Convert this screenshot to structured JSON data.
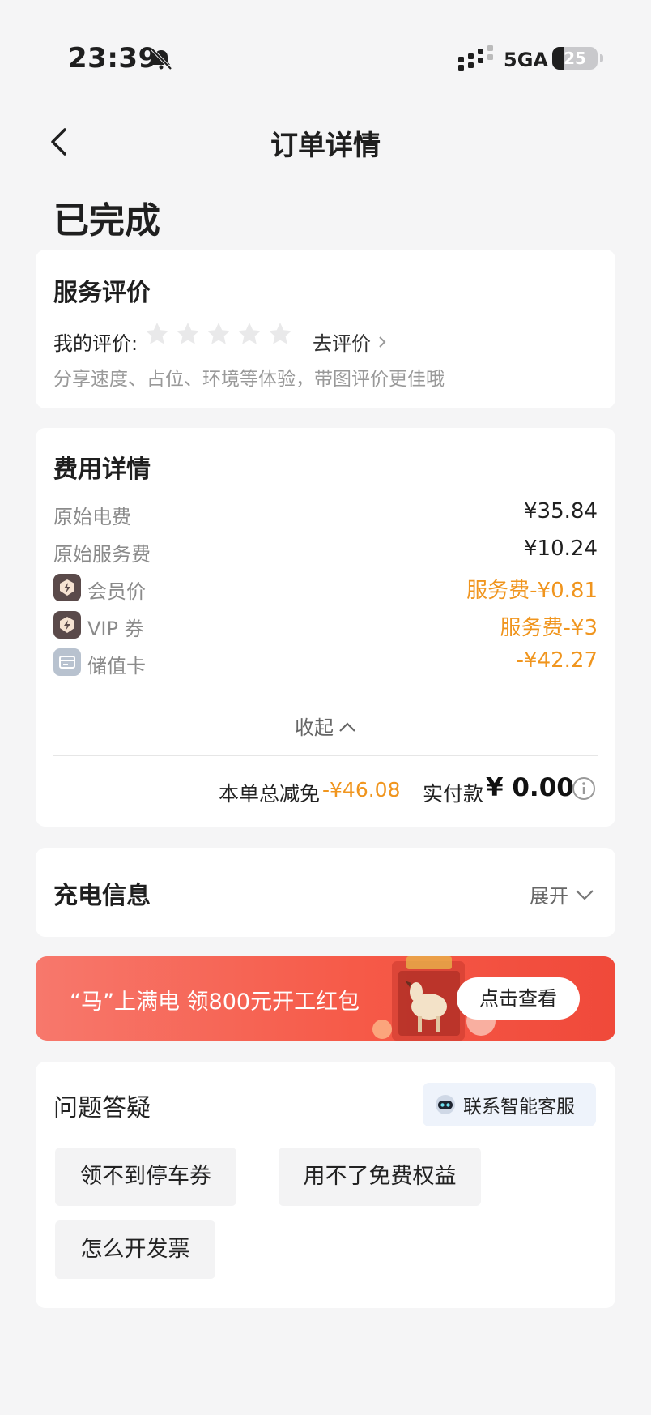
{
  "status_bar": {
    "time": "23:39",
    "network": "5GA",
    "battery": "25",
    "battery_level": 0.25,
    "icons": [
      "bell-off-icon",
      "signal-icon",
      "battery-icon"
    ]
  },
  "nav": {
    "title": "订单详情",
    "back_icon": "chevron-left-icon"
  },
  "order": {
    "status": "已完成"
  },
  "review": {
    "title": "服务评价",
    "my_rating_label": "我的评价:",
    "rating": 0,
    "max_rating": 5,
    "link_label": "去评价",
    "hint": "分享速度、占位、环境等体验，带图评价更佳哦"
  },
  "fees": {
    "title": "费用详情",
    "items": [
      {
        "label": "原始电费",
        "value": "¥35.84",
        "icon": null,
        "highlight": false
      },
      {
        "label": "原始服务费",
        "value": "¥10.24",
        "icon": null,
        "highlight": false
      },
      {
        "label": "会员价",
        "value": "服务费-¥0.81",
        "icon": "vip-lightning-icon",
        "highlight": true
      },
      {
        "label": "VIP 券",
        "value": "服务费-¥3",
        "icon": "vip-lightning-icon",
        "highlight": true
      },
      {
        "label": "储值卡",
        "value": "-¥42.27",
        "icon": "card-icon",
        "highlight": true
      }
    ],
    "collapse_label": "收起",
    "total_discount_label": "本单总减免",
    "total_discount": "-¥46.08",
    "paid_label": "实付款",
    "paid_amount": "¥ 0.00"
  },
  "charging": {
    "title": "充电信息",
    "expand_label": "展开"
  },
  "banner": {
    "text": "“马”上满电 领800元开工红包",
    "button_label": "点击查看"
  },
  "qa": {
    "title": "问题答疑",
    "service_button_label": "联系智能客服",
    "chips": [
      "领不到停车券",
      "用不了免费权益",
      "怎么开发票"
    ]
  },
  "colors": {
    "accent_orange": "#f0951e",
    "banner_red": "#f65a48",
    "background": "#f5f5f6"
  }
}
